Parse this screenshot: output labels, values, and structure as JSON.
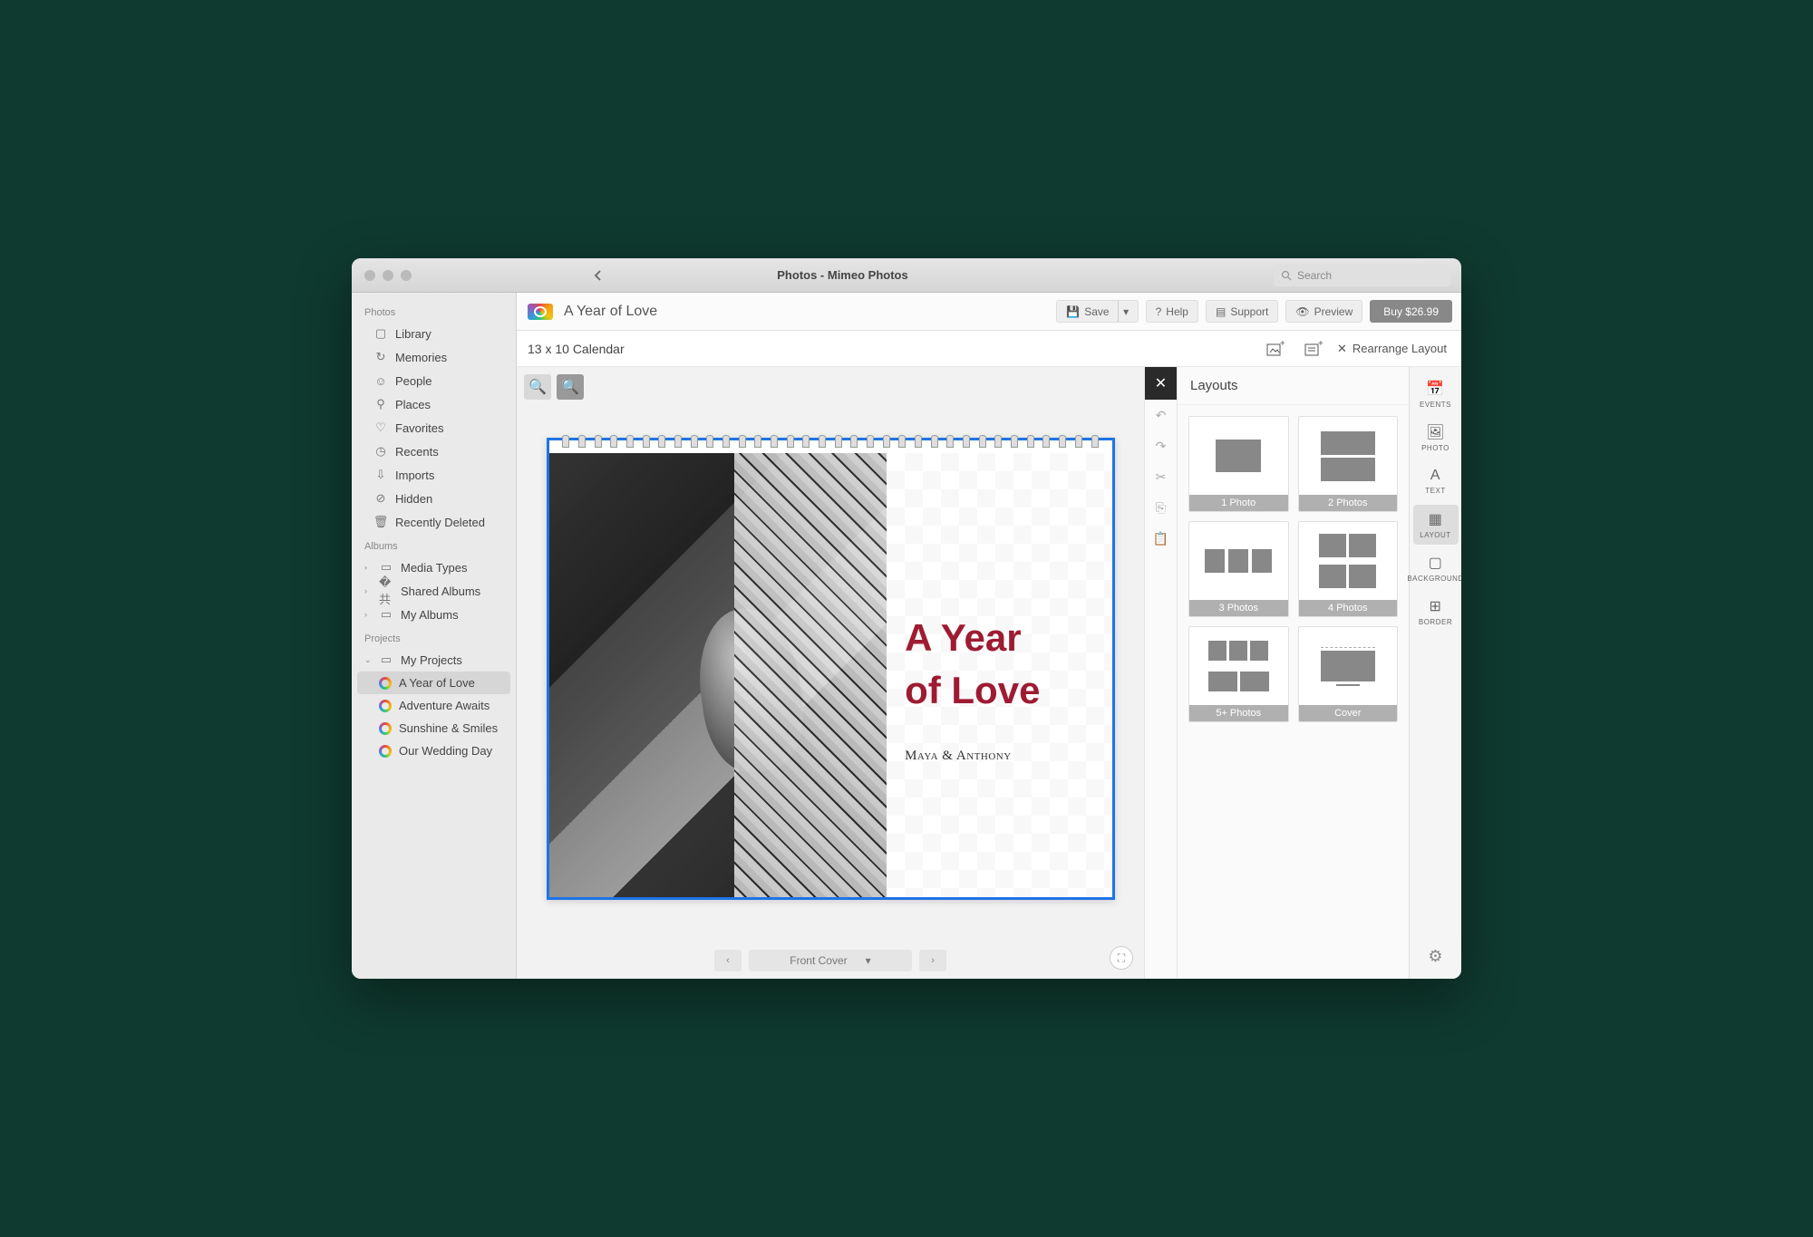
{
  "window": {
    "title": "Photos - Mimeo Photos",
    "search_placeholder": "Search"
  },
  "sidebar": {
    "photos_header": "Photos",
    "photos_items": [
      "Library",
      "Memories",
      "People",
      "Places",
      "Favorites",
      "Recents",
      "Imports",
      "Hidden",
      "Recently Deleted"
    ],
    "albums_header": "Albums",
    "albums_items": [
      "Media Types",
      "Shared Albums",
      "My Albums"
    ],
    "projects_header": "Projects",
    "projects_root": "My Projects",
    "projects": [
      "A Year of Love",
      "Adventure Awaits",
      "Sunshine & Smiles",
      "Our Wedding Day"
    ]
  },
  "toolbar": {
    "project_title": "A Year of Love",
    "save": "Save",
    "help": "Help",
    "support": "Support",
    "preview": "Preview",
    "buy": "Buy  $26.99",
    "product": "13 x 10 Calendar",
    "rearrange": "Rearrange Layout"
  },
  "canvas": {
    "title_line1": "A Year",
    "title_line2": "of Love",
    "subtitle": "Maya & Anthony",
    "page_label": "Front Cover"
  },
  "layouts": {
    "header": "Layouts",
    "items": [
      "1 Photo",
      "2 Photos",
      "3 Photos",
      "4 Photos",
      "5+ Photos",
      "Cover"
    ]
  },
  "rail": {
    "items": [
      "EVENTS",
      "PHOTO",
      "TEXT",
      "LAYOUT",
      "BACKGROUND",
      "BORDER"
    ]
  }
}
